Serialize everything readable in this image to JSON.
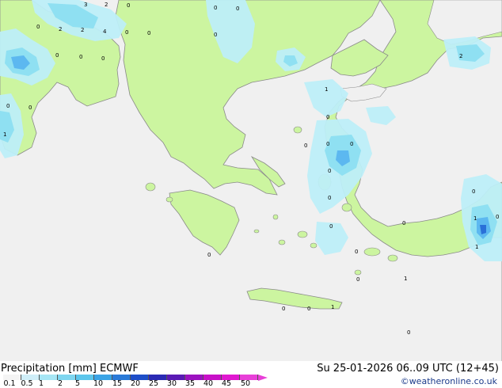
{
  "title": "Precipitation [mm]  ECMWF",
  "valid_time": "Su 25-01-2026 06..09 UTC (12+45)",
  "credit": "©weatheronline.co.uk",
  "colors": {
    "sea": "#f0f0f0",
    "land": "#ccf5a0",
    "coast": "#8a8a8a",
    "precip_light": "#bdeef8",
    "precip_mid": "#8fe0f2",
    "precip_heavy": "#5cb8f0",
    "precip_max": "#2a70d8"
  },
  "legend": {
    "colors": [
      "#f4f4f4",
      "#cfeef8",
      "#a6e6f5",
      "#7ed6f0",
      "#5cc6ec",
      "#3aa4e6",
      "#2a7ad8",
      "#1e4ec8",
      "#2a2ab4",
      "#5a1ab4",
      "#9c12c0",
      "#c810c8",
      "#e018d0",
      "#e840d8"
    ],
    "ticks": [
      "0.1",
      "0.5",
      "1",
      "2",
      "5",
      "10",
      "15",
      "20",
      "25",
      "30",
      "35",
      "40",
      "45",
      "50"
    ]
  },
  "point_labels": [
    "3",
    "2",
    "0",
    "2",
    "2",
    "4",
    "0",
    "0",
    "0",
    "0",
    "0",
    "0",
    "0",
    "0",
    "0",
    "2",
    "1",
    "0",
    "0",
    "1",
    "0",
    "0",
    "0",
    "0",
    "0",
    "0",
    "0",
    "0",
    "1",
    "0",
    "0",
    "0",
    "1",
    "0",
    "0",
    "1",
    "0",
    "0",
    "1",
    "0"
  ]
}
